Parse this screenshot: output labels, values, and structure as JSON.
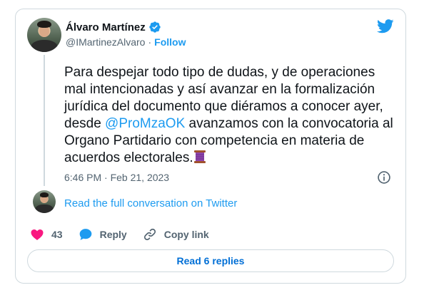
{
  "author": {
    "display_name": "Álvaro Martínez",
    "handle": "@IMartinezAlvaro",
    "separator": "·",
    "follow_label": "Follow"
  },
  "tweet": {
    "text_before": "Para despejar todo tipo de dudas, y de operaciones mal intencionadas y así avanzar en la formalización jurídica del documento que diéramos a conocer ayer, desde ",
    "mention": "@ProMzaOK",
    "text_after": " avanzamos con la convocatoria al Organo Partidario con competencia en materia de acuerdos electorales.",
    "emoji_icon": "thread-spool-icon",
    "timestamp": "6:46 PM · Feb 21, 2023"
  },
  "conversation": {
    "read_full_label": "Read the full conversation on Twitter"
  },
  "actions": {
    "like_count": "43",
    "reply_label": "Reply",
    "copy_link_label": "Copy link"
  },
  "replies_button": {
    "label": "Read 6 replies"
  },
  "colors": {
    "accent": "#1d9bf0",
    "like": "#f91880",
    "text": "#0f1419",
    "muted": "#536471",
    "border": "#cfd9de"
  }
}
